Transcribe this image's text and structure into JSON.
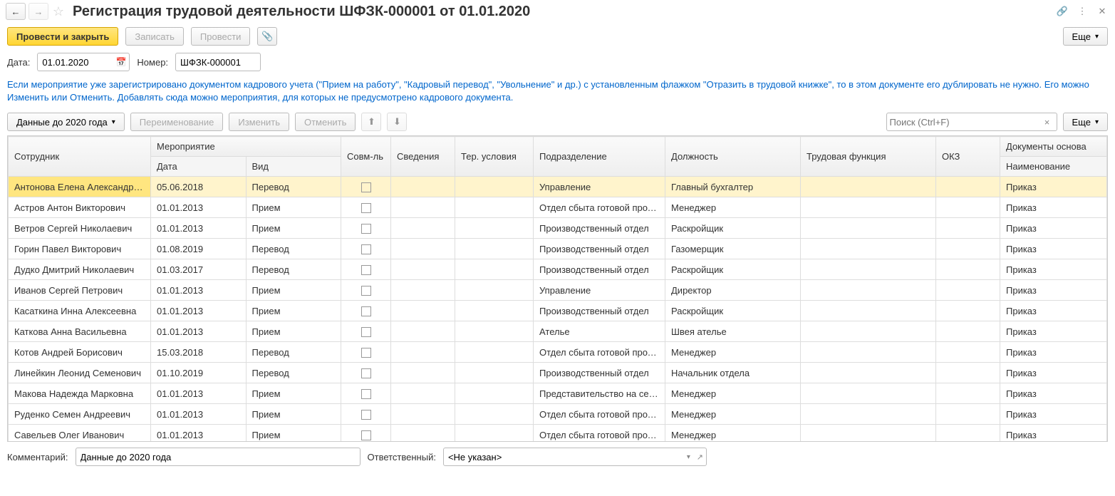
{
  "header": {
    "title": "Регистрация трудовой деятельности ШФЗК-000001 от 01.01.2020"
  },
  "cmdbar": {
    "post_close": "Провести и закрыть",
    "write": "Записать",
    "post": "Провести",
    "more_top": "Еще"
  },
  "form": {
    "date_label": "Дата:",
    "date_value": "01.01.2020",
    "number_label": "Номер:",
    "number_value": "ШФЗК-000001"
  },
  "info": "Если мероприятие уже зарегистрировано документом кадрового учета (\"Прием на работу\", \"Кадровый перевод\", \"Увольнение\" и др.) с установленным флажком \"Отразить в трудовой книжке\", то в этом документе его дублировать не нужно. Его можно Изменить или Отменить. Добавлять сюда можно мероприятия, для которых не предусмотрено кадрового документа.",
  "tablebar": {
    "data_before": "Данные до 2020 года",
    "rename": "Переименование",
    "edit": "Изменить",
    "cancel": "Отменить",
    "search_placeholder": "Поиск (Ctrl+F)",
    "more": "Еще"
  },
  "columns": {
    "employee": "Сотрудник",
    "event": "Мероприятие",
    "date": "Дата",
    "kind": "Вид",
    "sovm": "Совм-ль",
    "sved": "Сведения",
    "ter": "Тер. условия",
    "dept": "Подразделение",
    "position": "Должность",
    "func": "Трудовая функция",
    "okz": "ОКЗ",
    "doc": "Документы основа",
    "doc_name": "Наименование"
  },
  "rows": [
    {
      "emp": "Антонова Елена Александров...",
      "date": "05.06.2018",
      "kind": "Перевод",
      "dept": "Управление",
      "pos": "Главный бухгалтер",
      "doc": "Приказ",
      "sel": true
    },
    {
      "emp": "Астров Антон Викторович",
      "date": "01.01.2013",
      "kind": "Прием",
      "dept": "Отдел сбыта готовой прод...",
      "pos": "Менеджер",
      "doc": "Приказ"
    },
    {
      "emp": "Ветров Сергей Николаевич",
      "date": "01.01.2013",
      "kind": "Прием",
      "dept": "Производственный отдел",
      "pos": "Раскройщик",
      "doc": "Приказ"
    },
    {
      "emp": "Горин Павел Викторович",
      "date": "01.08.2019",
      "kind": "Перевод",
      "dept": "Производственный отдел",
      "pos": "Газомерщик",
      "doc": "Приказ"
    },
    {
      "emp": "Дудко Дмитрий Николаевич",
      "date": "01.03.2017",
      "kind": "Перевод",
      "dept": "Производственный отдел",
      "pos": "Раскройщик",
      "doc": "Приказ"
    },
    {
      "emp": "Иванов Сергей Петрович",
      "date": "01.01.2013",
      "kind": "Прием",
      "dept": "Управление",
      "pos": "Директор",
      "doc": "Приказ"
    },
    {
      "emp": "Касаткина Инна Алексеевна",
      "date": "01.01.2013",
      "kind": "Прием",
      "dept": "Производственный отдел",
      "pos": "Раскройщик",
      "doc": "Приказ"
    },
    {
      "emp": "Каткова Анна Васильевна",
      "date": "01.01.2013",
      "kind": "Прием",
      "dept": "Ателье",
      "pos": "Швея ателье",
      "doc": "Приказ"
    },
    {
      "emp": "Котов Андрей Борисович",
      "date": "15.03.2018",
      "kind": "Перевод",
      "dept": "Отдел сбыта готовой прод...",
      "pos": "Менеджер",
      "doc": "Приказ"
    },
    {
      "emp": "Линейкин Леонид Семенович",
      "date": "01.10.2019",
      "kind": "Перевод",
      "dept": "Производственный отдел",
      "pos": "Начальник отдела",
      "doc": "Приказ"
    },
    {
      "emp": "Макова Надежда Марковна",
      "date": "01.01.2013",
      "kind": "Прием",
      "dept": "Представительство на сев...",
      "pos": "Менеджер",
      "doc": "Приказ"
    },
    {
      "emp": "Руденко Семен Андреевич",
      "date": "01.01.2013",
      "kind": "Прием",
      "dept": "Отдел сбыта готовой прод...",
      "pos": "Менеджер",
      "doc": "Приказ"
    },
    {
      "emp": "Савельев Олег Иванович",
      "date": "01.01.2013",
      "kind": "Прием",
      "dept": "Отдел сбыта готовой прод...",
      "pos": "Менеджер",
      "doc": "Приказ"
    }
  ],
  "footer": {
    "comment_label": "Комментарий:",
    "comment_value": "Данные до 2020 года",
    "resp_label": "Ответственный:",
    "resp_value": "<Не указан>"
  }
}
